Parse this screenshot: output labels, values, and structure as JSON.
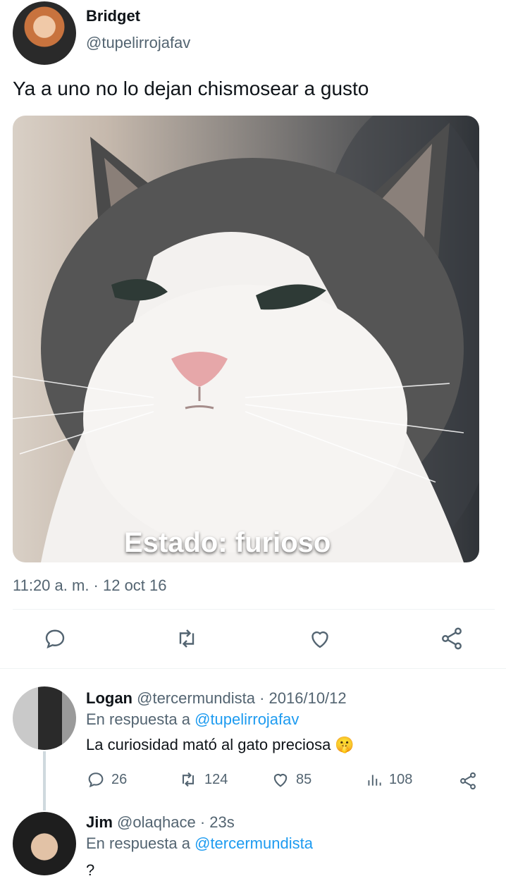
{
  "tweet": {
    "author_name": "Bridget",
    "author_handle": "@tupelirrojafav",
    "text": "Ya a uno no lo dejan chismosear a gusto",
    "image_caption": "Estado: furioso",
    "timestamp": "11:20 a. m. · 12 oct 16",
    "actions": [
      "reply-icon",
      "retweet-icon",
      "like-icon",
      "share-icon"
    ]
  },
  "replies": [
    {
      "name": "Logan",
      "handle": "@tercermundista",
      "time": "· 2016/10/12",
      "reply_prefix": "En respuesta a",
      "reply_to": "@tupelirrojafav",
      "text": "La curiosidad mató al gato preciosa 🤫",
      "stats": {
        "replies": "26",
        "retweets": "124",
        "likes": "85",
        "views": "108"
      }
    },
    {
      "name": "Jim",
      "handle": "@olaqhace",
      "time": "· 23s",
      "reply_prefix": "En respuesta a",
      "reply_to": "@tercermundista",
      "text": "?"
    }
  ],
  "colors": {
    "accent": "#1d9bf0",
    "muted": "#536471",
    "text": "#0f1419"
  }
}
